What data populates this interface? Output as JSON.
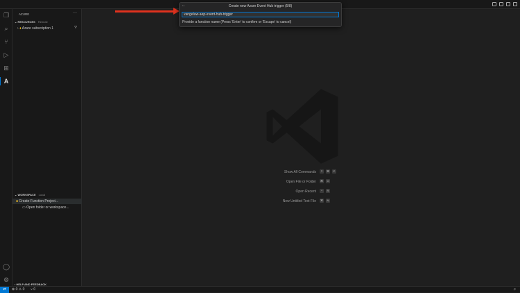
{
  "quickpick": {
    "title": "Create new Azure Event Hub trigger (5/8)",
    "value": "vangeluw-aep-event-hub-trigger",
    "message": "Provide a function name (Press 'Enter' to confirm or 'Escape' to cancel)"
  },
  "sidebar": {
    "title": "AZURE",
    "resources": {
      "label": "RESOURCES",
      "sub": "Remote",
      "items": [
        {
          "label": "Azure subscription 1"
        }
      ]
    },
    "workspace": {
      "label": "WORKSPACE",
      "sub": "Local",
      "items": [
        {
          "label": "Create Function Project..."
        },
        {
          "label": "Open folder or workspace..."
        }
      ]
    },
    "help": "HELP AND FEEDBACK"
  },
  "commands": [
    {
      "label": "Show All Commands",
      "keys": [
        "⇧",
        "⌘",
        "P"
      ]
    },
    {
      "label": "Open File or Folder",
      "keys": [
        "⌘",
        "O"
      ]
    },
    {
      "label": "Open Recent",
      "keys": [
        "^",
        "R"
      ]
    },
    {
      "label": "New Untitled Text File",
      "keys": [
        "⌘",
        "N"
      ]
    }
  ],
  "status": {
    "errors": "0",
    "warnings": "0",
    "ports": "0"
  },
  "colors": {
    "accent": "#0078d4",
    "arrow": "#e0321e"
  }
}
